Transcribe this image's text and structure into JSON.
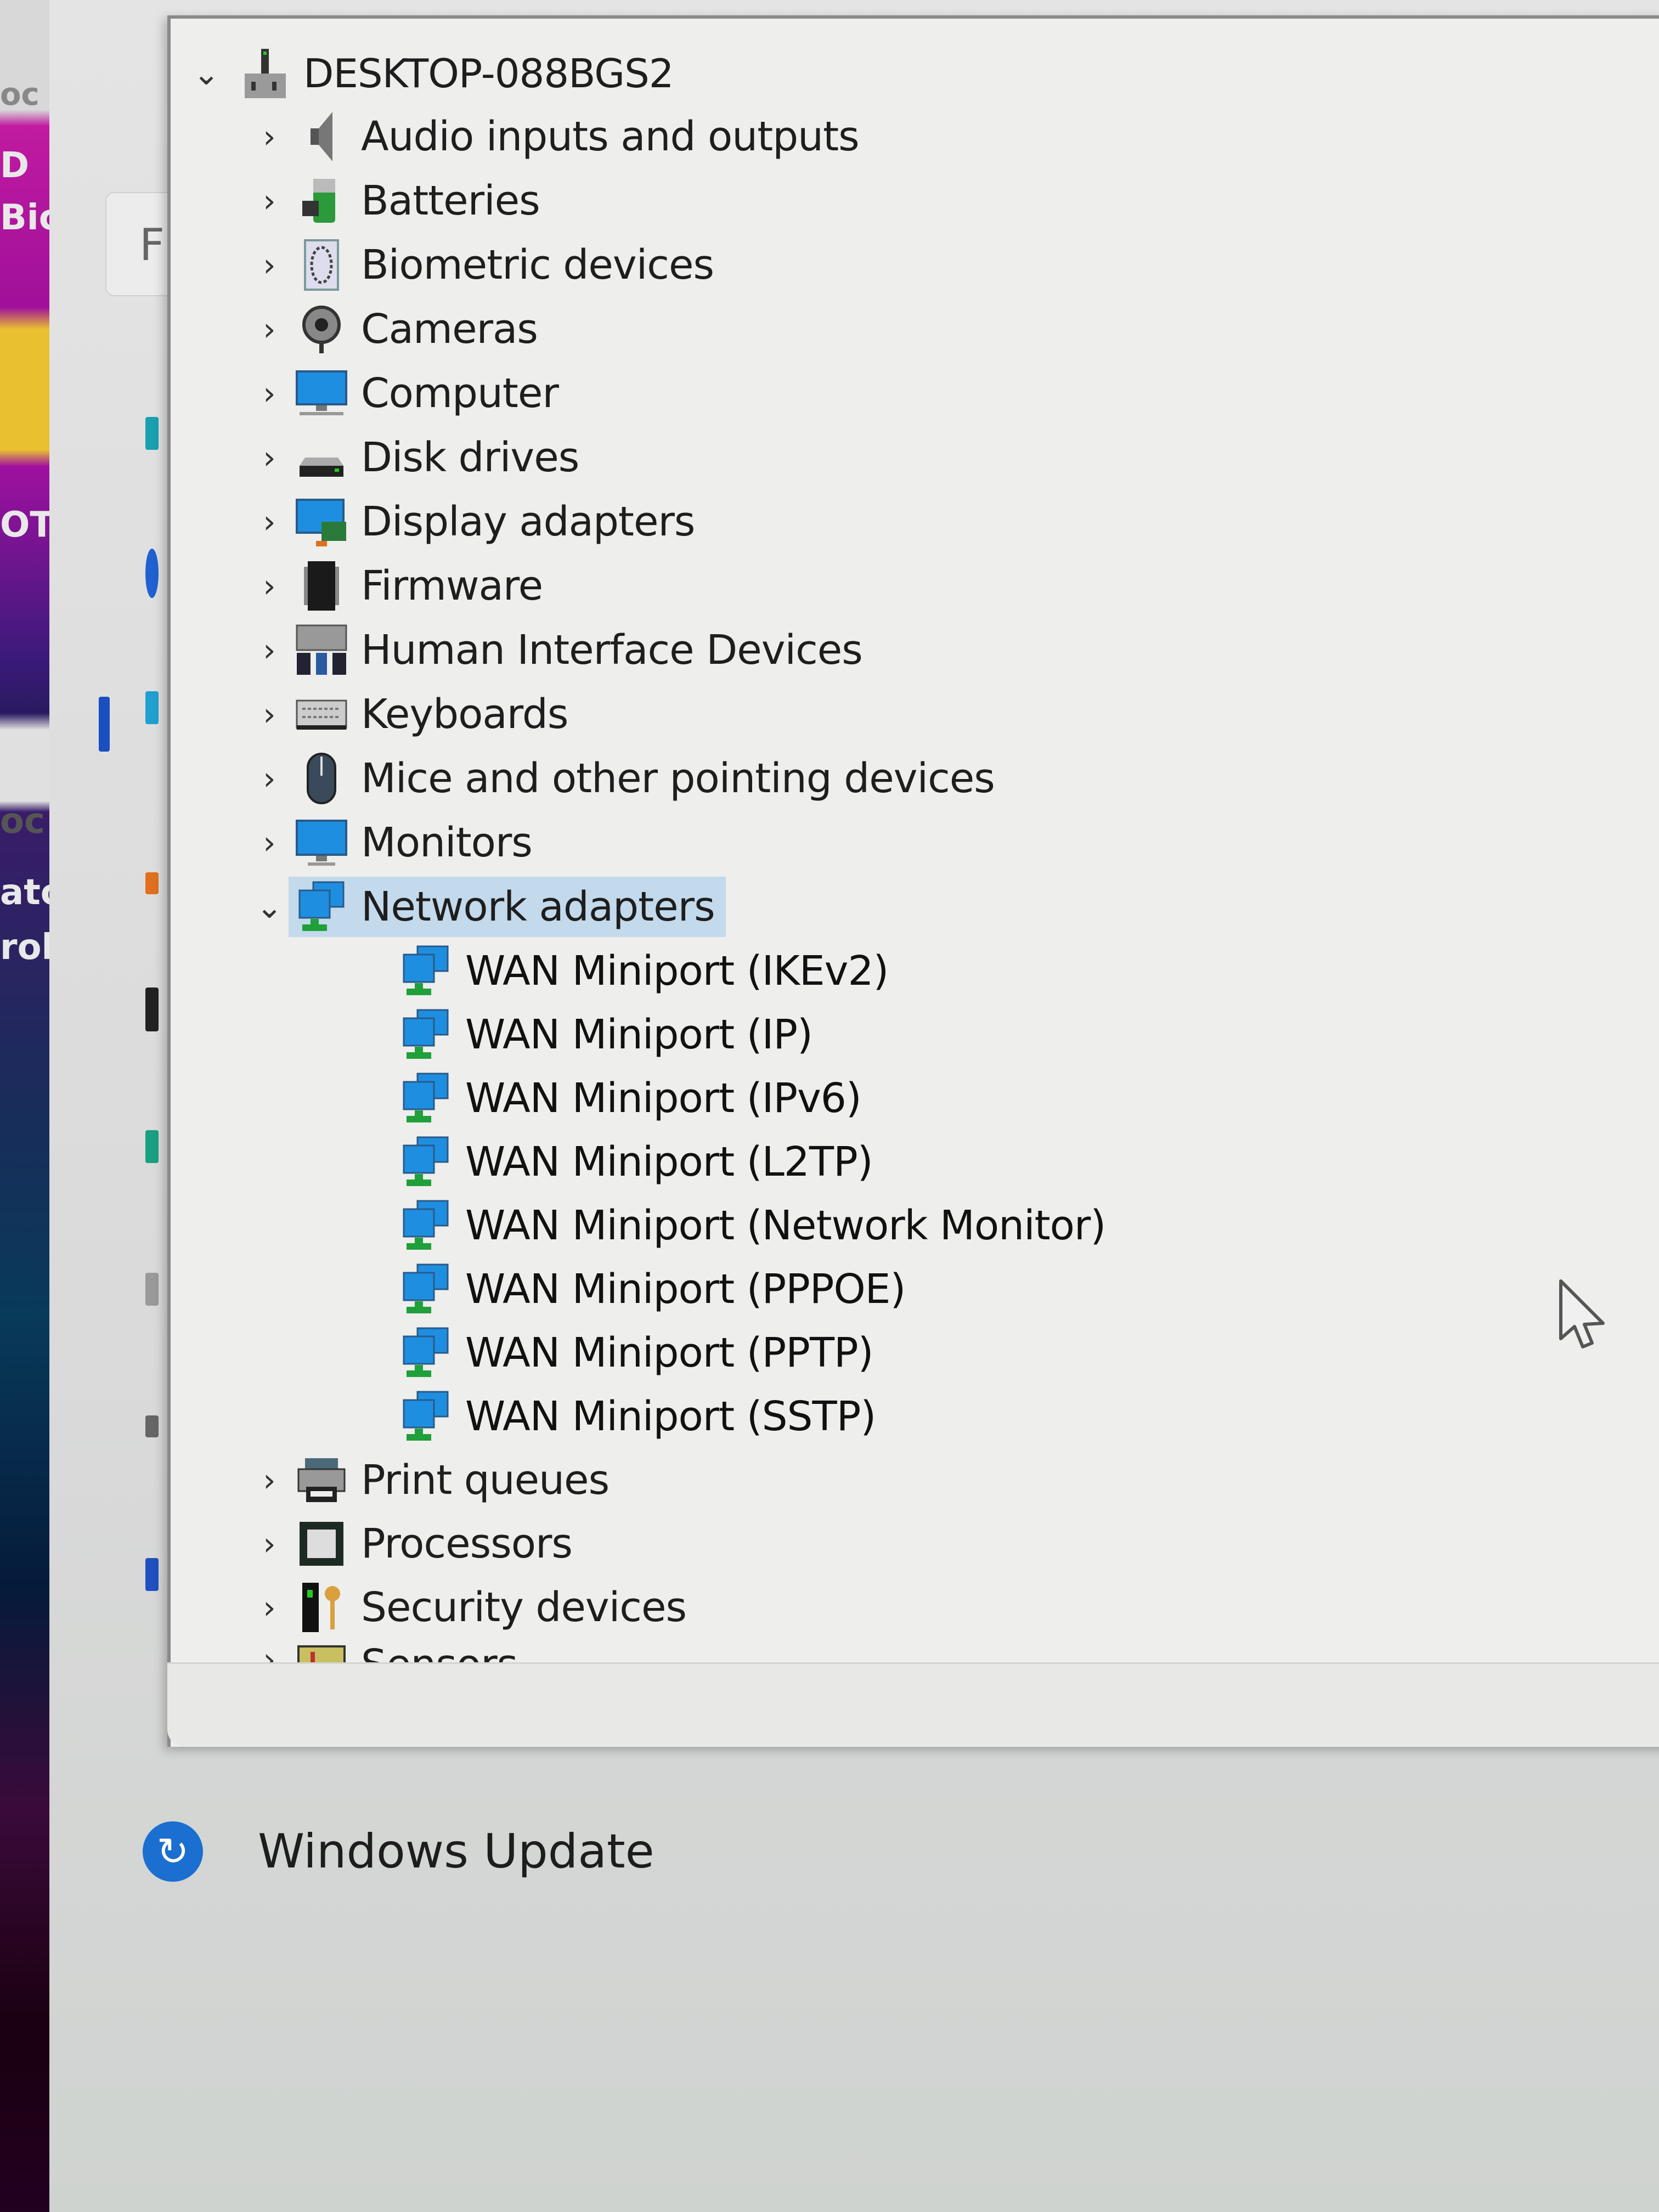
{
  "background": {
    "left_strip_fragments": [
      "oc",
      "D",
      "Bic",
      "OTH",
      "oc",
      "ato",
      "rol"
    ],
    "settings_tab_letter": "F"
  },
  "device_manager": {
    "root": {
      "label": "DESKTOP-088BGS2",
      "expanded": true,
      "icon": "computer-tower-icon"
    },
    "categories": [
      {
        "label": "Audio inputs and outputs",
        "icon": "speaker-icon",
        "expanded": false
      },
      {
        "label": "Batteries",
        "icon": "battery-icon",
        "expanded": false
      },
      {
        "label": "Biometric devices",
        "icon": "fingerprint-icon",
        "expanded": false
      },
      {
        "label": "Cameras",
        "icon": "webcam-icon",
        "expanded": false
      },
      {
        "label": "Computer",
        "icon": "monitor-icon",
        "expanded": false
      },
      {
        "label": "Disk drives",
        "icon": "disk-drive-icon",
        "expanded": false
      },
      {
        "label": "Display adapters",
        "icon": "display-adapter-icon",
        "expanded": false
      },
      {
        "label": "Firmware",
        "icon": "chip-icon",
        "expanded": false
      },
      {
        "label": "Human Interface Devices",
        "icon": "hid-icon",
        "expanded": false
      },
      {
        "label": "Keyboards",
        "icon": "keyboard-icon",
        "expanded": false
      },
      {
        "label": "Mice and other pointing devices",
        "icon": "mouse-icon",
        "expanded": false
      },
      {
        "label": "Monitors",
        "icon": "monitor-icon",
        "expanded": false
      },
      {
        "label": "Network adapters",
        "icon": "network-adapter-icon",
        "expanded": true,
        "selected": true,
        "children": [
          "WAN Miniport (IKEv2)",
          "WAN Miniport (IP)",
          "WAN Miniport (IPv6)",
          "WAN Miniport (L2TP)",
          "WAN Miniport (Network Monitor)",
          "WAN Miniport (PPPOE)",
          "WAN Miniport (PPTP)",
          "WAN Miniport (SSTP)"
        ]
      },
      {
        "label": "Print queues",
        "icon": "printer-icon",
        "expanded": false
      },
      {
        "label": "Processors",
        "icon": "processor-icon",
        "expanded": false
      },
      {
        "label": "Security devices",
        "icon": "security-key-icon",
        "expanded": false
      },
      {
        "label": "Sensors",
        "icon": "sensor-icon",
        "expanded": false
      }
    ]
  },
  "settings": {
    "windows_update_label": "Windows Update"
  },
  "colors": {
    "selection": "#c3d9ec",
    "network_blue": "#1e8fe0",
    "network_green": "#1fa03a",
    "update_blue": "#1a6fd0"
  }
}
